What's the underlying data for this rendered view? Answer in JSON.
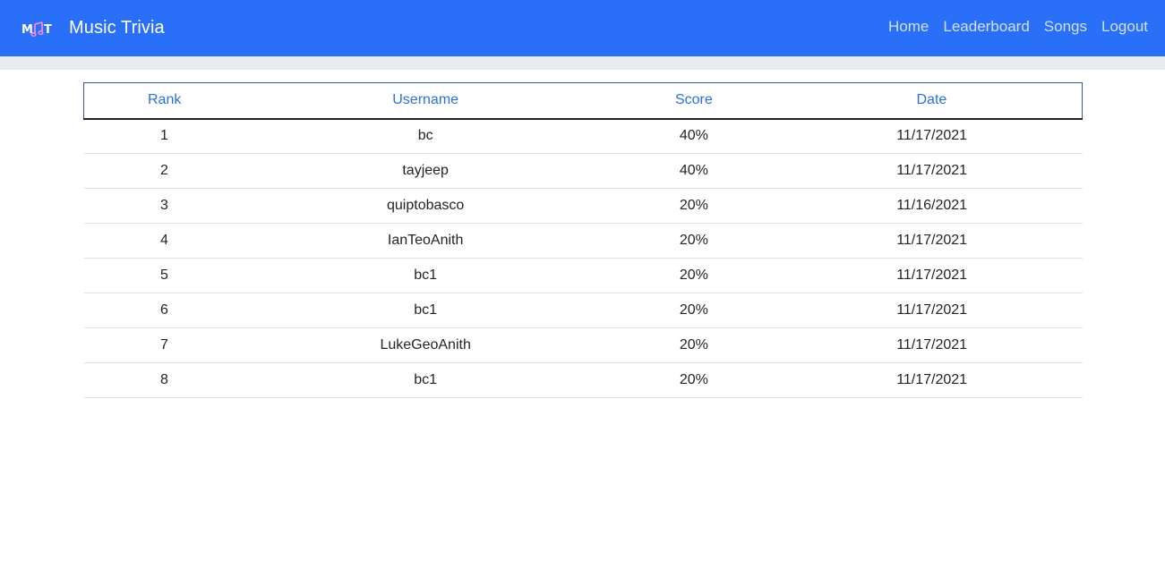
{
  "app": {
    "title": "Music Trivia",
    "logo_icon": "music-note-logo-icon"
  },
  "nav": {
    "items": [
      {
        "label": "Home"
      },
      {
        "label": "Leaderboard"
      },
      {
        "label": "Songs"
      },
      {
        "label": "Logout"
      }
    ]
  },
  "colors": {
    "navbar": "#2a6ff7",
    "header_text": "#2b6fe0",
    "subbar": "#e9ecef"
  },
  "leaderboard": {
    "columns": [
      "Rank",
      "Username",
      "Score",
      "Date"
    ],
    "rows": [
      {
        "rank": "1",
        "username": "bc",
        "score": "40%",
        "date": "11/17/2021"
      },
      {
        "rank": "2",
        "username": "tayjeep",
        "score": "40%",
        "date": "11/17/2021"
      },
      {
        "rank": "3",
        "username": "quiptobasco",
        "score": "20%",
        "date": "11/16/2021"
      },
      {
        "rank": "4",
        "username": "IanTeoAnith",
        "score": "20%",
        "date": "11/17/2021"
      },
      {
        "rank": "5",
        "username": "bc1",
        "score": "20%",
        "date": "11/17/2021"
      },
      {
        "rank": "6",
        "username": "bc1",
        "score": "20%",
        "date": "11/17/2021"
      },
      {
        "rank": "7",
        "username": "LukeGeoAnith",
        "score": "20%",
        "date": "11/17/2021"
      },
      {
        "rank": "8",
        "username": "bc1",
        "score": "20%",
        "date": "11/17/2021"
      }
    ]
  }
}
